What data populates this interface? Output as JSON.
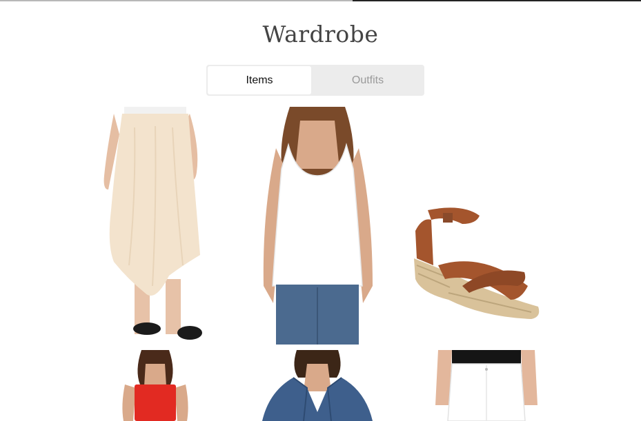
{
  "header": {
    "title": "Wardrobe",
    "progress_fraction": 0.55
  },
  "tabs": [
    {
      "label": "Items",
      "active": true
    },
    {
      "label": "Outfits",
      "active": false
    }
  ],
  "items": [
    {
      "name": "cream-midi-skirt"
    },
    {
      "name": "white-tank-top"
    },
    {
      "name": "brown-espadrille-wedge-sandal"
    },
    {
      "name": "red-strapless-top"
    },
    {
      "name": "denim-jacket"
    },
    {
      "name": "white-jeans"
    }
  ],
  "colors": {
    "title": "#444444",
    "tab_bg": "#ececec",
    "tab_active_bg": "#ffffff",
    "tab_inactive_text": "#9a9a9a"
  }
}
